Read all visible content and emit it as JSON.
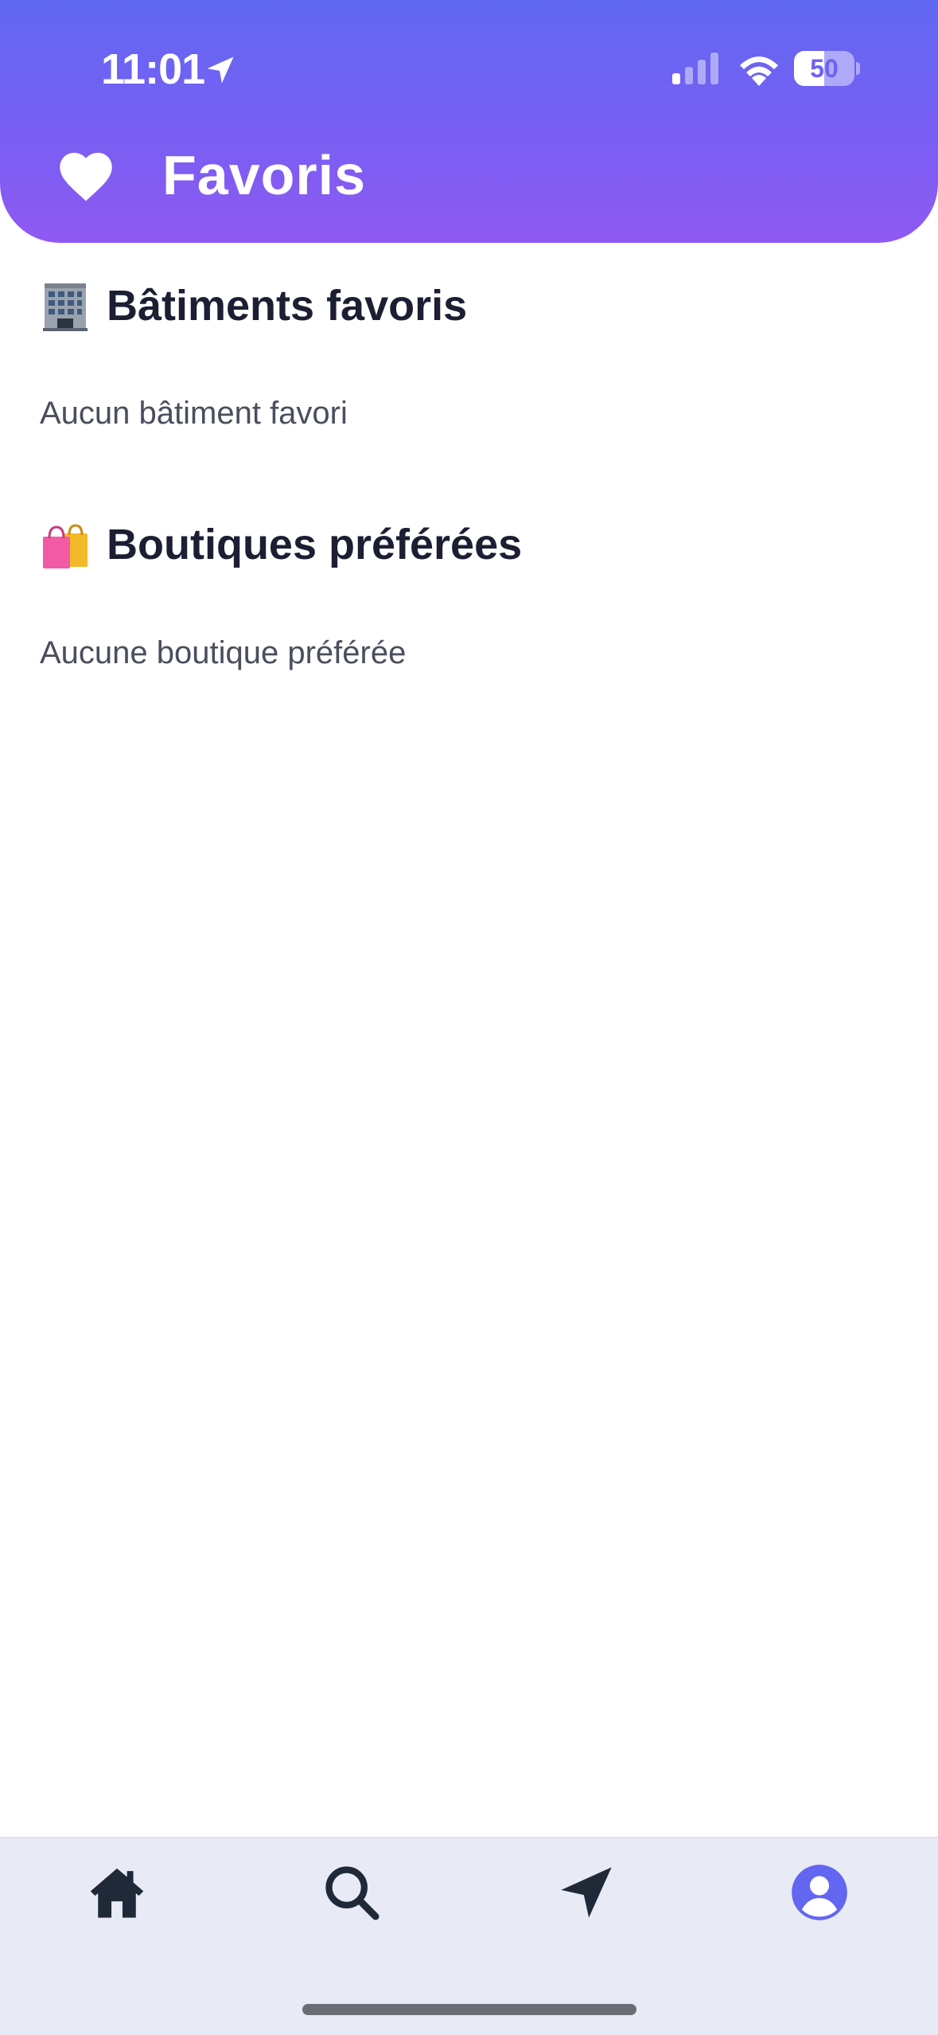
{
  "status_bar": {
    "time": "11:01",
    "battery_level": "50",
    "battery_fraction": 0.5,
    "icons": [
      "location-arrow-icon",
      "cellular-signal-icon",
      "wifi-icon",
      "battery-icon"
    ]
  },
  "header": {
    "title": "Favoris",
    "icon": "heart-icon",
    "gradient_colors": [
      "#6068f1",
      "#8f59f3"
    ]
  },
  "sections": [
    {
      "icon": "office-building-icon",
      "title": "Bâtiments favoris",
      "empty_message": "Aucun bâtiment favori"
    },
    {
      "icon": "shopping-bags-icon",
      "title": "Boutiques préférées",
      "empty_message": "Aucune boutique préférée"
    }
  ],
  "tab_bar": {
    "tabs": [
      {
        "icon": "home-icon",
        "active": false
      },
      {
        "icon": "search-icon",
        "active": false
      },
      {
        "icon": "navigation-arrow-icon",
        "active": false
      },
      {
        "icon": "profile-icon",
        "active": true
      }
    ],
    "active_color": "#6366f1",
    "inactive_color": "#1f2937",
    "background": "#e8eaf6"
  }
}
